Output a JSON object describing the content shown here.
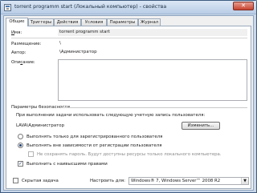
{
  "window": {
    "title": "torrent programm start (Локальный компьютер) - свойства",
    "close_glyph": "✕"
  },
  "tabs": [
    {
      "label": "Общие",
      "active": true
    },
    {
      "label": "Триггеры",
      "active": false
    },
    {
      "label": "Действия",
      "active": false
    },
    {
      "label": "Условия",
      "active": false
    },
    {
      "label": "Параметры",
      "active": false
    },
    {
      "label": "Журнал",
      "active": false
    }
  ],
  "general": {
    "name_label": "Имя:",
    "name_value": "torrent programm start",
    "location_label": "Размещение:",
    "location_value": "\\",
    "author_label": "Автор:",
    "author_value": "\\Администратор",
    "description_label": "Описание:",
    "description_value": ""
  },
  "security": {
    "group_title": "Параметры безопасности",
    "run_as_label": "При выполнении задачи использовать следующую учетную запись пользователя:",
    "user_account": "LAVA\\Администратор",
    "change_button": "Изменить...",
    "radio_logged_on": "Выполнять только для зарегистрированного пользователя",
    "radio_whether_logged": "Выполнять вне зависимости от регистрации пользователя",
    "radio_selected": "whether_logged",
    "no_store_password": "Не сохранять пароль. Будут доступны ресурсы только локального компьютера.",
    "no_store_password_checked": false,
    "highest_privileges": "Выполнить с наивысшими правами",
    "highest_privileges_checked": true
  },
  "footer": {
    "hidden_label": "Скрытая задача",
    "hidden_checked": false,
    "configure_label": "Настроить для:",
    "configure_value": "Windows® 7, Windows Server™ 2008 R2"
  },
  "icons": {
    "checkmark": "✓",
    "dropdown": "▼"
  }
}
